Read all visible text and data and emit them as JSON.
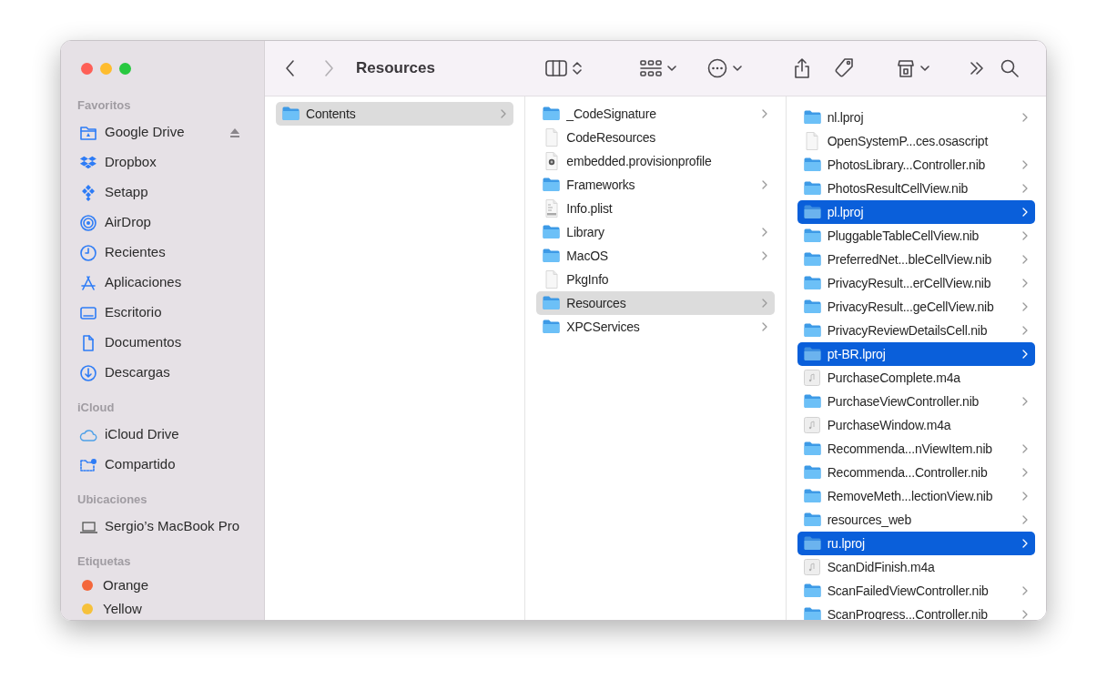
{
  "toolbar": {
    "back": {
      "disabled": false
    },
    "forward": {
      "disabled": true
    },
    "title": "Resources"
  },
  "sidebar": [
    {
      "heading": "Favoritos",
      "items": [
        {
          "label": "Google Drive",
          "kind": "drive",
          "eject": true
        },
        {
          "label": "Dropbox",
          "kind": "dropbox",
          "eject": false
        },
        {
          "label": "Setapp",
          "kind": "setapp",
          "eject": false
        },
        {
          "label": "AirDrop",
          "kind": "airdrop",
          "eject": false
        },
        {
          "label": "Recientes",
          "kind": "clock",
          "eject": false
        },
        {
          "label": "Aplicaciones",
          "kind": "apps",
          "eject": false
        },
        {
          "label": "Escritorio",
          "kind": "desktop",
          "eject": false
        },
        {
          "label": "Documentos",
          "kind": "document",
          "eject": false
        },
        {
          "label": "Descargas",
          "kind": "download",
          "eject": false
        }
      ]
    },
    {
      "heading": "iCloud",
      "items": [
        {
          "label": "iCloud Drive",
          "kind": "cloud",
          "eject": false
        },
        {
          "label": "Compartido",
          "kind": "shared",
          "eject": false
        }
      ]
    },
    {
      "heading": "Ubicaciones",
      "items": [
        {
          "label": "Sergio’s MacBook Pro",
          "kind": "laptop",
          "eject": false
        }
      ]
    },
    {
      "heading": "Etiquetas",
      "items": [
        {
          "label": "Orange",
          "kind": "tag",
          "color": "#f4673b",
          "eject": false
        },
        {
          "label": "Yellow",
          "kind": "tag",
          "color": "#f6c13b",
          "eject": false
        }
      ]
    }
  ],
  "columns": [
    {
      "focused": false,
      "items": [
        {
          "name": "Contents",
          "kind": "folder",
          "selected": true
        }
      ]
    },
    {
      "focused": false,
      "items": [
        {
          "name": "_CodeSignature",
          "kind": "folder",
          "selected": false
        },
        {
          "name": "CodeResources",
          "kind": "file",
          "selected": false
        },
        {
          "name": "embedded.provisionprofile",
          "kind": "profile",
          "selected": false
        },
        {
          "name": "Frameworks",
          "kind": "folder",
          "selected": false
        },
        {
          "name": "Info.plist",
          "kind": "plist",
          "selected": false
        },
        {
          "name": "Library",
          "kind": "folder",
          "selected": false
        },
        {
          "name": "MacOS",
          "kind": "folder",
          "selected": false
        },
        {
          "name": "PkgInfo",
          "kind": "file",
          "selected": false
        },
        {
          "name": "Resources",
          "kind": "folder",
          "selected": true
        },
        {
          "name": "XPCServices",
          "kind": "folder",
          "selected": false
        }
      ]
    },
    {
      "focused": true,
      "items": [
        {
          "name": "nl.lproj",
          "kind": "folder",
          "selected": false
        },
        {
          "name": "OpenSystemP...ces.osascript",
          "kind": "file",
          "selected": false
        },
        {
          "name": "PhotosLibrary...Controller.nib",
          "kind": "folder",
          "selected": false
        },
        {
          "name": "PhotosResultCellView.nib",
          "kind": "folder",
          "selected": false
        },
        {
          "name": "pl.lproj",
          "kind": "folder",
          "selected": true
        },
        {
          "name": "PluggableTableCellView.nib",
          "kind": "folder",
          "selected": false
        },
        {
          "name": "PreferredNet...bleCellView.nib",
          "kind": "folder",
          "selected": false
        },
        {
          "name": "PrivacyResult...erCellView.nib",
          "kind": "folder",
          "selected": false
        },
        {
          "name": "PrivacyResult...geCellView.nib",
          "kind": "folder",
          "selected": false
        },
        {
          "name": "PrivacyReviewDetailsCell.nib",
          "kind": "folder",
          "selected": false
        },
        {
          "name": "pt-BR.lproj",
          "kind": "folder",
          "selected": true
        },
        {
          "name": "PurchaseComplete.m4a",
          "kind": "audio",
          "selected": false
        },
        {
          "name": "PurchaseViewController.nib",
          "kind": "folder",
          "selected": false
        },
        {
          "name": "PurchaseWindow.m4a",
          "kind": "audio",
          "selected": false
        },
        {
          "name": "Recommenda...nViewItem.nib",
          "kind": "folder",
          "selected": false
        },
        {
          "name": "Recommenda...Controller.nib",
          "kind": "folder",
          "selected": false
        },
        {
          "name": "RemoveMeth...lectionView.nib",
          "kind": "folder",
          "selected": false
        },
        {
          "name": "resources_web",
          "kind": "folder",
          "selected": false
        },
        {
          "name": "ru.lproj",
          "kind": "folder",
          "selected": true
        },
        {
          "name": "ScanDidFinish.m4a",
          "kind": "audio",
          "selected": false
        },
        {
          "name": "ScanFailedViewController.nib",
          "kind": "folder",
          "selected": false
        },
        {
          "name": "ScanProgress...Controller.nib",
          "kind": "folder",
          "selected": false
        }
      ]
    }
  ]
}
